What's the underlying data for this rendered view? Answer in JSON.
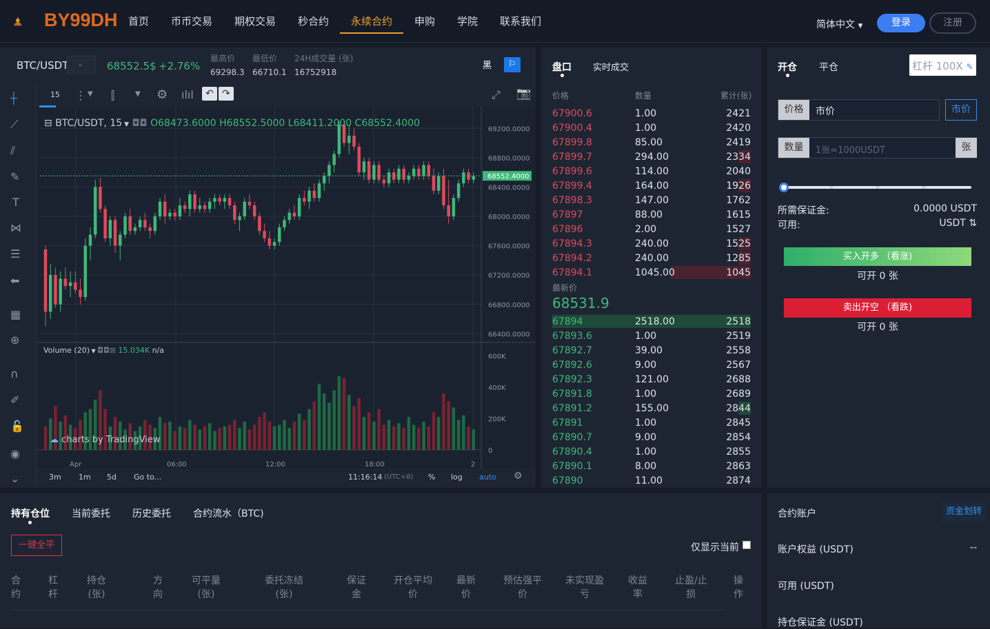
{
  "header": {
    "logo_text": "BY99DH",
    "nav": [
      "首页",
      "币币交易",
      "期权交易",
      "秒合约",
      "永续合约",
      "申购",
      "学院",
      "联系我们"
    ],
    "language": "简体中文",
    "login": "登录",
    "register": "注册"
  },
  "ticker": {
    "symbol": "BTC/USDT",
    "last_price": "68552.5$",
    "change": "+2.76%",
    "high_label": "最高价",
    "high": "69298.3",
    "low_label": "最低价",
    "low": "66710.1",
    "volume_label": "24H成交量 (张)",
    "volume": "16752918",
    "theme_dark": "黑"
  },
  "chart": {
    "interval": "15",
    "legend": "BTC/USDT, 15",
    "ohlc": {
      "o": "O68473.6000",
      "h": "H68552.5000",
      "l": "L68411.2000",
      "c": "C68552.4000"
    },
    "price_ticks": [
      "69200.0000",
      "68800.0000",
      "68400.0000",
      "68000.0000",
      "67600.0000",
      "67200.0000",
      "66800.0000",
      "66400.0000"
    ],
    "current_price_tag": "68552.4000",
    "volume_legend": "Volume (20)",
    "volume_value": "15.034K",
    "volume_na": "n/a",
    "volume_ticks": [
      "600K",
      "400K",
      "200K",
      "0"
    ],
    "time_ticks": [
      "Apr",
      "06:00",
      "12:00",
      "18:00",
      "2"
    ],
    "watermark": "charts by TradingView",
    "ranges": [
      "3m",
      "1m",
      "5d",
      "Go to..."
    ],
    "clock": "11:16:14",
    "tz": "(UTC+8)",
    "pct": "%",
    "log": "log",
    "auto": "auto",
    "colors": {
      "up": "#3fb87a",
      "down": "#e04a5c",
      "bg": "#1a2230"
    }
  },
  "chart_data": {
    "type": "candlestick",
    "title": "BTC/USDT, 15",
    "ylim": [
      66300,
      69400
    ],
    "candles": [
      [
        67550,
        67600,
        66500,
        66700
      ],
      [
        66700,
        67350,
        66600,
        67200
      ],
      [
        67200,
        67300,
        66750,
        66800
      ],
      [
        66800,
        67250,
        66700,
        67150
      ],
      [
        67150,
        67300,
        67000,
        67050
      ],
      [
        67050,
        67250,
        66900,
        67100
      ],
      [
        67100,
        67250,
        66950,
        67000
      ],
      [
        67000,
        67150,
        66800,
        66900
      ],
      [
        66900,
        67700,
        66850,
        67600
      ],
      [
        67600,
        67850,
        67400,
        67750
      ],
      [
        67750,
        68500,
        67700,
        68400
      ],
      [
        68400,
        68520,
        68050,
        68100
      ],
      [
        68100,
        68150,
        67650,
        67700
      ],
      [
        67700,
        68000,
        67600,
        67950
      ],
      [
        67950,
        68000,
        67500,
        67600
      ],
      [
        67600,
        67800,
        67400,
        67750
      ],
      [
        67750,
        68050,
        67700,
        68000
      ],
      [
        68000,
        68100,
        67750,
        67800
      ],
      [
        67800,
        67900,
        67750,
        67850
      ],
      [
        67850,
        68000,
        67800,
        67950
      ],
      [
        67950,
        68050,
        67800,
        67850
      ],
      [
        67850,
        67900,
        67700,
        67800
      ],
      [
        67800,
        68050,
        67750,
        68000
      ],
      [
        68000,
        68250,
        67950,
        68200
      ],
      [
        68200,
        68300,
        67900,
        68000
      ],
      [
        68000,
        68100,
        67950,
        68050
      ],
      [
        68050,
        68100,
        67950,
        68000
      ],
      [
        68000,
        68250,
        67950,
        68150
      ],
      [
        68150,
        68200,
        68050,
        68100
      ],
      [
        68100,
        68350,
        68000,
        68300
      ],
      [
        68300,
        68350,
        68050,
        68100
      ],
      [
        68100,
        68250,
        68050,
        68150
      ],
      [
        68150,
        68200,
        68050,
        68100
      ],
      [
        68100,
        68250,
        68050,
        68200
      ],
      [
        68200,
        68300,
        68100,
        68250
      ],
      [
        68250,
        68300,
        68150,
        68200
      ],
      [
        68200,
        68300,
        68100,
        68250
      ],
      [
        68250,
        68300,
        68100,
        68150
      ],
      [
        68150,
        68200,
        67900,
        67950
      ],
      [
        67950,
        68050,
        67800,
        68000
      ],
      [
        68000,
        68250,
        67950,
        68200
      ],
      [
        68200,
        68300,
        68100,
        68150
      ],
      [
        68150,
        68200,
        67950,
        68000
      ],
      [
        68000,
        68050,
        67750,
        67800
      ],
      [
        67800,
        67900,
        67650,
        67700
      ],
      [
        67700,
        67800,
        67550,
        67600
      ],
      [
        67600,
        67700,
        67550,
        67650
      ],
      [
        67650,
        67900,
        67600,
        67850
      ],
      [
        67850,
        68000,
        67800,
        67950
      ],
      [
        67950,
        68100,
        67900,
        68050
      ],
      [
        68050,
        68150,
        67950,
        68000
      ],
      [
        68000,
        68300,
        67950,
        68250
      ],
      [
        68250,
        68350,
        68150,
        68200
      ],
      [
        68200,
        68400,
        68100,
        68350
      ],
      [
        68350,
        68450,
        68200,
        68250
      ],
      [
        68250,
        68500,
        68200,
        68450
      ],
      [
        68450,
        68600,
        68350,
        68550
      ],
      [
        68550,
        68750,
        68450,
        68700
      ],
      [
        68700,
        68900,
        68600,
        68850
      ],
      [
        68850,
        69300,
        68800,
        69250
      ],
      [
        69250,
        69300,
        68950,
        69000
      ],
      [
        69000,
        69250,
        68850,
        69100
      ],
      [
        69100,
        69200,
        68900,
        68950
      ],
      [
        68950,
        69000,
        68550,
        68600
      ],
      [
        68600,
        68800,
        68500,
        68750
      ],
      [
        68750,
        68800,
        68450,
        68500
      ],
      [
        68500,
        68750,
        68450,
        68700
      ],
      [
        68700,
        68750,
        68450,
        68500
      ],
      [
        68500,
        68550,
        68400,
        68450
      ],
      [
        68450,
        68650,
        68400,
        68600
      ],
      [
        68600,
        68650,
        68450,
        68500
      ],
      [
        68500,
        68700,
        68450,
        68650
      ],
      [
        68650,
        68700,
        68450,
        68500
      ],
      [
        68500,
        68600,
        68450,
        68550
      ],
      [
        68550,
        68700,
        68500,
        68650
      ],
      [
        68650,
        68700,
        68500,
        68550
      ],
      [
        68550,
        68750,
        68500,
        68700
      ],
      [
        68700,
        68750,
        68500,
        68550
      ],
      [
        68550,
        68650,
        68300,
        68350
      ],
      [
        68350,
        68600,
        68300,
        68550
      ],
      [
        68550,
        68650,
        68100,
        68150
      ],
      [
        68150,
        68500,
        67900,
        68000
      ],
      [
        68000,
        68300,
        67950,
        68250
      ],
      [
        68250,
        68500,
        68200,
        68450
      ],
      [
        68450,
        68650,
        68400,
        68600
      ],
      [
        68600,
        68650,
        68450,
        68500
      ],
      [
        68500,
        68600,
        68450,
        68550
      ]
    ],
    "volumes": [
      150,
      200,
      280,
      180,
      220,
      160,
      140,
      190,
      240,
      260,
      320,
      380,
      260,
      150,
      210,
      180,
      130,
      170,
      120,
      150,
      190,
      160,
      140,
      210,
      170,
      180,
      120,
      150,
      140,
      190,
      160,
      130,
      150,
      170,
      120,
      140,
      150,
      160,
      190,
      140,
      180,
      130,
      160,
      210,
      240,
      180,
      150,
      160,
      190,
      140,
      180,
      230,
      190,
      260,
      310,
      420,
      360,
      300,
      380,
      470,
      460,
      350,
      280,
      330,
      210,
      240,
      180,
      260,
      160,
      190,
      150,
      170,
      140,
      210,
      160,
      140,
      180,
      150,
      240,
      210,
      360,
      310,
      270,
      190,
      220,
      150,
      130
    ]
  },
  "orderbook": {
    "tab_book": "盘口",
    "tab_trades": "实时成交",
    "h_price": "价格",
    "h_qty": "数量",
    "h_total": "累计(张)",
    "asks": [
      [
        "67900.6",
        "1.00",
        "2421"
      ],
      [
        "67900.4",
        "1.00",
        "2420"
      ],
      [
        "67899.8",
        "85.00",
        "2419"
      ],
      [
        "67899.7",
        "294.00",
        "2334"
      ],
      [
        "67899.6",
        "114.00",
        "2040"
      ],
      [
        "67899.4",
        "164.00",
        "1926"
      ],
      [
        "67898.3",
        "147.00",
        "1762"
      ],
      [
        "67897",
        "88.00",
        "1615"
      ],
      [
        "67896",
        "2.00",
        "1527"
      ],
      [
        "67894.3",
        "240.00",
        "1525"
      ],
      [
        "67894.2",
        "240.00",
        "1285"
      ],
      [
        "67894.1",
        "1045.00",
        "1045"
      ]
    ],
    "last_label": "最新价",
    "last": "68531.9",
    "bids": [
      [
        "67894",
        "2518.00",
        "2518"
      ],
      [
        "67893.6",
        "1.00",
        "2519"
      ],
      [
        "67892.7",
        "39.00",
        "2558"
      ],
      [
        "67892.6",
        "9.00",
        "2567"
      ],
      [
        "67892.3",
        "121.00",
        "2688"
      ],
      [
        "67891.8",
        "1.00",
        "2689"
      ],
      [
        "67891.2",
        "155.00",
        "2844"
      ],
      [
        "67891",
        "1.00",
        "2845"
      ],
      [
        "67890.7",
        "9.00",
        "2854"
      ],
      [
        "67890.4",
        "1.00",
        "2855"
      ],
      [
        "67890.1",
        "8.00",
        "2863"
      ],
      [
        "67890",
        "11.00",
        "2874"
      ]
    ]
  },
  "trade": {
    "tab_open": "开仓",
    "tab_close": "平仓",
    "leverage": "杠杆 100X",
    "price_label": "价格",
    "price_value": "市价",
    "market_btn": "市价",
    "qty_label": "数量",
    "qty_placeholder": "1张≈1000USDT",
    "qty_unit": "张",
    "margin_label": "所需保证金:",
    "margin_value": "0.0000 USDT",
    "avail_label": "可用:",
    "avail_value": "USDT",
    "buy": "买入开多 （看涨)",
    "buy_hint": "可开 0 张",
    "sell": "卖出开空 （看跌)",
    "sell_hint": "可开 0 张",
    "slider_level": 0
  },
  "positions": {
    "tabs": [
      "持有仓位",
      "当前委托",
      "历史委托",
      "合约流水（BTC)"
    ],
    "close_all": "一键全平",
    "only_current": "仅显示当前",
    "columns": [
      [
        "合",
        "约"
      ],
      [
        "杠",
        "杆"
      ],
      [
        "持仓",
        "(张)"
      ],
      [
        "方",
        "向"
      ],
      [
        "可平量",
        "(张)"
      ],
      [
        "委托冻结",
        "(张)"
      ],
      [
        "保证",
        "金"
      ],
      [
        "开仓平均",
        "价"
      ],
      [
        "最新",
        "价"
      ],
      [
        "预估强平",
        "价"
      ],
      [
        "未实现盈",
        "亏"
      ],
      [
        "收益",
        "率"
      ],
      [
        "止盈/止",
        "损"
      ],
      [
        "操",
        "作"
      ]
    ]
  },
  "account": {
    "title": "合约账户",
    "transfer": "资金划转",
    "equity_label": "账户权益 (USDT)",
    "equity_value": "--",
    "avail_label": "可用 (USDT)",
    "margin_label": "持仓保证金 (USDT)"
  }
}
